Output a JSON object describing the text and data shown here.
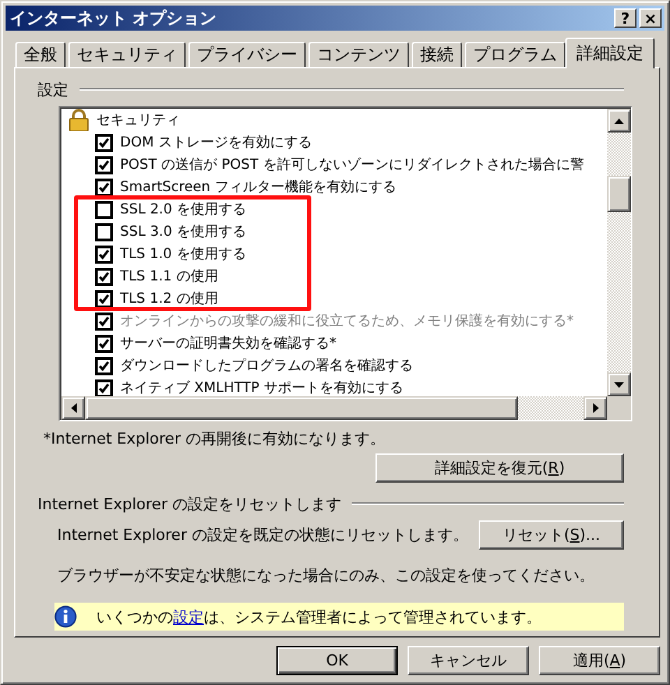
{
  "window": {
    "title": "インターネット オプション",
    "help_button": "?",
    "close_button": "×"
  },
  "tabs": [
    {
      "label": "全般",
      "selected": false
    },
    {
      "label": "セキュリティ",
      "selected": false
    },
    {
      "label": "プライバシー",
      "selected": false
    },
    {
      "label": "コンテンツ",
      "selected": false
    },
    {
      "label": "接続",
      "selected": false
    },
    {
      "label": "プログラム",
      "selected": false
    },
    {
      "label": "詳細設定",
      "selected": true
    }
  ],
  "settings_group": "設定",
  "settings_list": [
    {
      "kind": "category",
      "label": "セキュリティ",
      "children": [
        {
          "kind": "checkbox",
          "label": "DOM ストレージを有効にする",
          "checked": true,
          "disabled": false,
          "highlighted": false
        },
        {
          "kind": "checkbox",
          "label": "POST の送信が POST を許可しないゾーンにリダイレクトされた場合に警",
          "checked": true,
          "disabled": false,
          "highlighted": false
        },
        {
          "kind": "checkbox",
          "label": "SmartScreen フィルター機能を有効にする",
          "checked": true,
          "disabled": false,
          "highlighted": false
        },
        {
          "kind": "checkbox",
          "label": "SSL 2.0 を使用する",
          "checked": false,
          "disabled": false,
          "highlighted": true
        },
        {
          "kind": "checkbox",
          "label": "SSL 3.0 を使用する",
          "checked": false,
          "disabled": false,
          "highlighted": true
        },
        {
          "kind": "checkbox",
          "label": "TLS 1.0 を使用する",
          "checked": true,
          "disabled": false,
          "highlighted": true
        },
        {
          "kind": "checkbox",
          "label": "TLS 1.1 の使用",
          "checked": true,
          "disabled": false,
          "highlighted": true
        },
        {
          "kind": "checkbox",
          "label": "TLS 1.2 の使用",
          "checked": true,
          "disabled": false,
          "highlighted": true
        },
        {
          "kind": "checkbox",
          "label": "オンラインからの攻撃の緩和に役立てるため、メモリ保護を有効にする*",
          "checked": true,
          "disabled": true,
          "highlighted": false
        },
        {
          "kind": "checkbox",
          "label": "サーバーの証明書失効を確認する*",
          "checked": true,
          "disabled": false,
          "highlighted": false
        },
        {
          "kind": "checkbox",
          "label": "ダウンロードしたプログラムの署名を確認する",
          "checked": true,
          "disabled": false,
          "highlighted": false
        },
        {
          "kind": "checkbox",
          "label": "ネイティブ XMLHTTP サポートを有効にする",
          "checked": true,
          "disabled": false,
          "highlighted": false
        }
      ]
    }
  ],
  "restart_note": "*Internet Explorer の再開後に有効になります。",
  "restore_button": {
    "before": "詳細設定を復元(",
    "mnemonic": "R",
    "after": ")"
  },
  "reset_group": "Internet Explorer の設定をリセットします",
  "reset_description": "Internet Explorer の設定を既定の状態にリセットします。",
  "reset_button": {
    "before": "リセット(",
    "mnemonic": "S",
    "after": ")..."
  },
  "reset_warning": "ブラウザーが不安定な状態になった場合にのみ、この設定を使ってください。",
  "info_bar": {
    "before": "いくつかの",
    "link": "設定",
    "after": "は、システム管理者によって管理されています。"
  },
  "footer_buttons": [
    {
      "before": "OK"
    },
    {
      "before": "キャンセル"
    },
    {
      "before": "適用(",
      "mnemonic": "A",
      "after": ")"
    }
  ]
}
